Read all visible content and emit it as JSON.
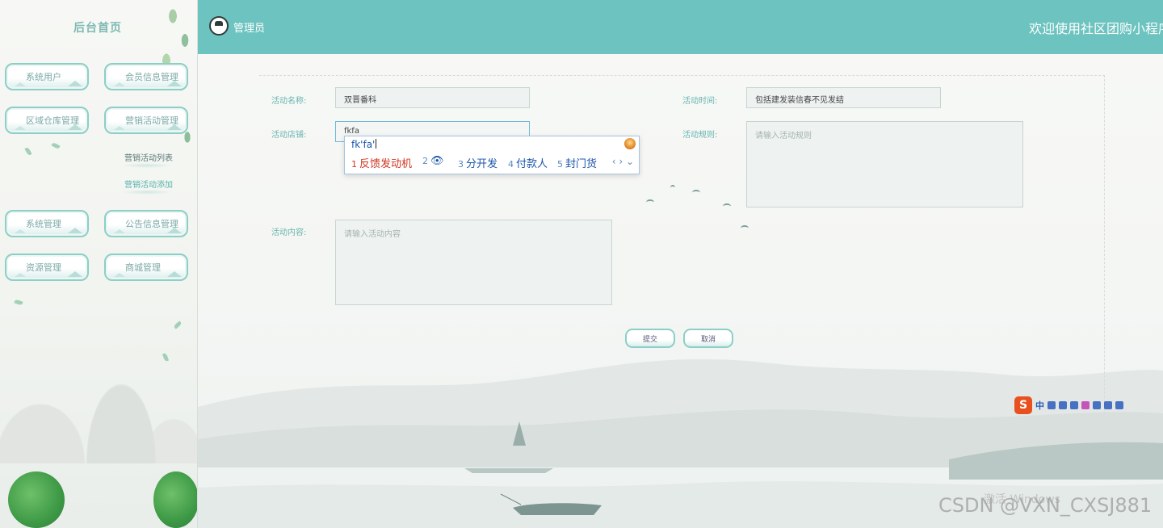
{
  "sidebar": {
    "title": "后台首页",
    "menu": {
      "system_users": "系统用户",
      "member_info": "会员信息管理",
      "warehouse": "区域仓库管理",
      "marketing": "营销活动管理",
      "system": "系统管理",
      "announcement": "公告信息管理",
      "resource": "资源管理",
      "mall": "商城管理"
    },
    "submenu": {
      "list": "营销活动列表",
      "add": "营销活动添加"
    }
  },
  "header": {
    "role": "管理员",
    "welcome": "欢迎使用社区团购小程序"
  },
  "form": {
    "name_label": "活动名称:",
    "name_value": "双晋番科",
    "time_label": "活动时间:",
    "time_value": "包括建发装信春不见发结",
    "shop_label": "活动店铺:",
    "shop_value": "fkfa",
    "rules_label": "活动规则:",
    "rules_placeholder": "请输入活动规则",
    "content_label": "活动内容:",
    "content_placeholder": "请输入活动内容",
    "submit": "提交",
    "cancel": "取消"
  },
  "ime": {
    "typed": "fk'fa'",
    "candidates": [
      {
        "n": "1",
        "text": "反馈发动机"
      },
      {
        "n": "2",
        "text": "👁"
      },
      {
        "n": "3",
        "text": "分开发"
      },
      {
        "n": "4",
        "text": "付款人"
      },
      {
        "n": "5",
        "text": "封门货"
      }
    ],
    "nav": "‹ › ⌄"
  },
  "tray": {
    "logo": "S",
    "lang": "中"
  },
  "watermark": "CSDN @VXN_CXSJ881",
  "activate_text": "激活 Windows"
}
